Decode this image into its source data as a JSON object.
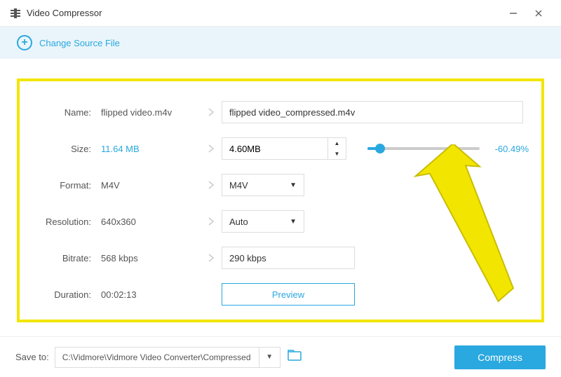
{
  "app": {
    "title": "Video Compressor"
  },
  "sourcebar": {
    "change_label": "Change Source File"
  },
  "labels": {
    "name": "Name:",
    "size": "Size:",
    "format": "Format:",
    "resolution": "Resolution:",
    "bitrate": "Bitrate:",
    "duration": "Duration:"
  },
  "original": {
    "name": "flipped video.m4v",
    "size": "11.64 MB",
    "format": "M4V",
    "resolution": "640x360",
    "bitrate": "568 kbps",
    "duration": "00:02:13"
  },
  "output": {
    "name": "flipped video_compressed.m4v",
    "size": "4.60MB",
    "size_pct": "-60.49%",
    "format": "M4V",
    "resolution": "Auto",
    "bitrate": "290 kbps"
  },
  "buttons": {
    "preview": "Preview",
    "compress": "Compress"
  },
  "footer": {
    "save_to": "Save to:",
    "path": "C:\\Vidmore\\Vidmore Video Converter\\Compressed"
  }
}
